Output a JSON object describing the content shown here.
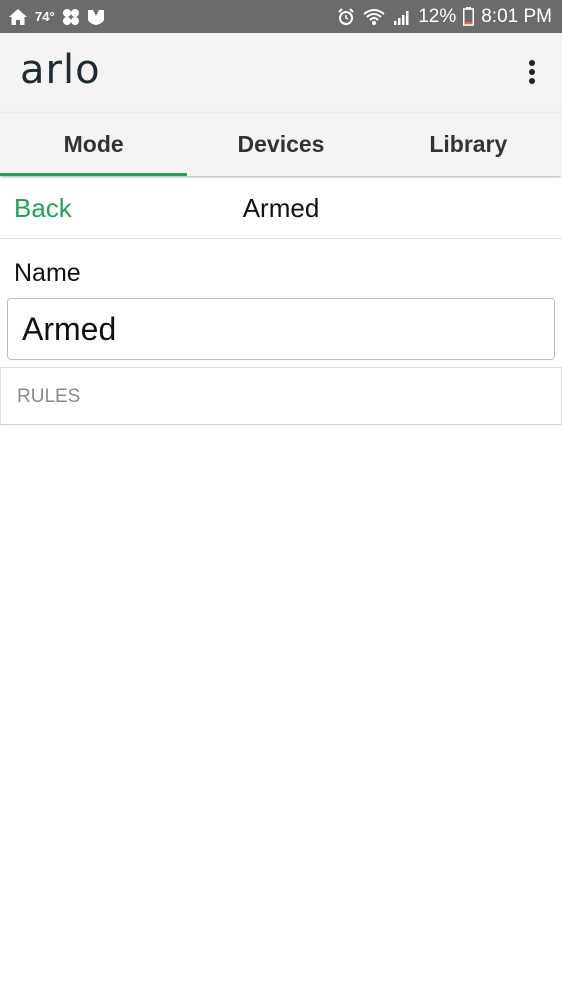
{
  "status_bar": {
    "temperature": "74°",
    "battery_percent": "12%",
    "time": "8:01 PM",
    "icons": [
      "home-icon",
      "flower-icon",
      "shield-icon",
      "alarm-icon",
      "wifi-icon",
      "signal-icon",
      "battery-icon"
    ]
  },
  "app_bar": {
    "logo_text": "arlo"
  },
  "tabs": [
    {
      "label": "Mode",
      "active": true
    },
    {
      "label": "Devices",
      "active": false
    },
    {
      "label": "Library",
      "active": false
    }
  ],
  "sub_header": {
    "back_label": "Back",
    "title": "Armed"
  },
  "form": {
    "name_label": "Name",
    "name_value": "Armed"
  },
  "rules": {
    "label": "RULES"
  },
  "colors": {
    "accent": "#1fa35a",
    "status_bar": "#6b6b6b",
    "app_bar": "#f4f4f4"
  }
}
